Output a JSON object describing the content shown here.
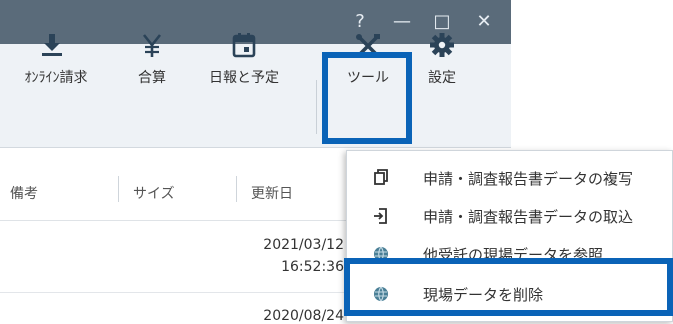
{
  "window": {
    "buttons": [
      "?",
      "—",
      "□",
      "✕"
    ]
  },
  "ribbon": {
    "items": [
      {
        "label": "ｵﾝﾗｲﾝ請求",
        "icon": "download-icon"
      },
      {
        "label": "合算",
        "icon": "yen-icon"
      },
      {
        "label": "日報と予定",
        "icon": "calendar-icon"
      },
      {
        "label": "ツール",
        "icon": "tools-icon"
      },
      {
        "label": "設定",
        "icon": "gear-icon"
      }
    ]
  },
  "grid": {
    "headers": [
      "備考",
      "サイズ",
      "更新日"
    ],
    "rows": [
      {
        "date": "2021/03/12",
        "time": "16:52:36"
      },
      {
        "date": "2020/08/24",
        "time": ""
      }
    ]
  },
  "menu": {
    "items": [
      {
        "label": "申請・調査報告書データの複写",
        "icon": "copy-icon"
      },
      {
        "label": "申請・調査報告書データの取込",
        "icon": "import-icon"
      },
      {
        "label": "他受託の現場データを参照",
        "icon": "globe-icon"
      },
      {
        "label": "現場データを削除",
        "icon": "globe-icon"
      }
    ]
  },
  "colors": {
    "titlebar": "#5a6b7a",
    "highlight": "#0a63b7",
    "ribbon_bg": "#eef2f6"
  }
}
